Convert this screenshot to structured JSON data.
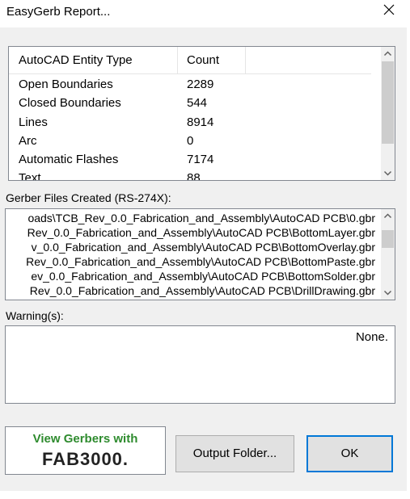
{
  "window": {
    "title": "EasyGerb Report..."
  },
  "entities": {
    "headers": [
      "AutoCAD Entity Type",
      "Count"
    ],
    "rows": [
      [
        "Open Boundaries",
        "2289"
      ],
      [
        "Closed Boundaries",
        "544"
      ],
      [
        "Lines",
        "8914"
      ],
      [
        "Arc",
        "0"
      ],
      [
        "Automatic Flashes",
        "7174"
      ],
      [
        "Text",
        "88"
      ]
    ]
  },
  "gerber": {
    "label": "Gerber Files Created (RS-274X):",
    "files": [
      "oads\\TCB_Rev_0.0_Fabrication_and_Assembly\\AutoCAD PCB\\0.gbr",
      "Rev_0.0_Fabrication_and_Assembly\\AutoCAD PCB\\BottomLayer.gbr",
      "v_0.0_Fabrication_and_Assembly\\AutoCAD PCB\\BottomOverlay.gbr",
      "Rev_0.0_Fabrication_and_Assembly\\AutoCAD PCB\\BottomPaste.gbr",
      "ev_0.0_Fabrication_and_Assembly\\AutoCAD PCB\\BottomSolder.gbr",
      "Rev_0.0_Fabrication_and_Assembly\\AutoCAD PCB\\DrillDrawing.gbr"
    ]
  },
  "warnings": {
    "label": "Warning(s):",
    "text": "None."
  },
  "buttons": {
    "fab_line1": "View Gerbers with",
    "fab_line2": "FAB3000.",
    "output": "Output Folder...",
    "ok": "OK"
  },
  "colors": {
    "accent": "#0078d7",
    "fab_green": "#2e8b2e"
  },
  "icons": [
    "close-icon",
    "scroll-up-arrow-icon",
    "scroll-down-arrow-icon"
  ]
}
